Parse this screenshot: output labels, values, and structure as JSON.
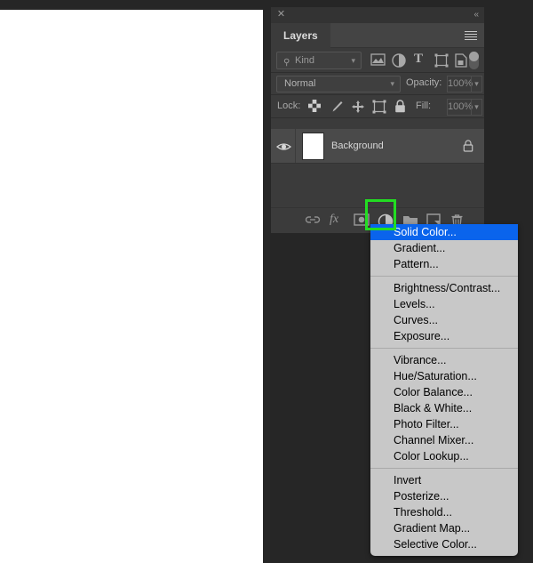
{
  "panel": {
    "close_icon": "close-x-icon",
    "collapse_icon": "double-chevron-left-icon",
    "tab_label": "Layers",
    "menu_icon": "hamburger-menu-icon",
    "filter": {
      "search_icon": "search-icon",
      "kind_label": "Kind",
      "chevron": "⌄",
      "icons": [
        {
          "name": "filter-pixel-icon",
          "glyph": "image"
        },
        {
          "name": "filter-adjustment-icon",
          "glyph": "half-circle"
        },
        {
          "name": "filter-type-icon",
          "glyph": "T"
        },
        {
          "name": "filter-shape-icon",
          "glyph": "shape"
        },
        {
          "name": "filter-smart-object-icon",
          "glyph": "smart"
        }
      ],
      "toggle_name": "filter-enable-toggle"
    },
    "blend": {
      "mode": "Normal",
      "chevron": "⌄",
      "opacity_label": "Opacity:",
      "opacity_value": "100%",
      "opacity_chevron": "⌄"
    },
    "lock": {
      "label": "Lock:",
      "icons": [
        {
          "name": "lock-transparent-pixels-icon"
        },
        {
          "name": "lock-image-pixels-icon"
        },
        {
          "name": "lock-position-icon"
        },
        {
          "name": "lock-artboard-nesting-icon"
        },
        {
          "name": "lock-all-icon"
        }
      ],
      "fill_label": "Fill:",
      "fill_value": "100%",
      "fill_chevron": "⌄"
    },
    "layers": [
      {
        "name": "Background",
        "visible": true,
        "locked": true,
        "thumb_color": "#ffffff"
      }
    ],
    "bottom_buttons": [
      {
        "name": "link-layers-button",
        "label": "link"
      },
      {
        "name": "layer-style-button",
        "label": "fx"
      },
      {
        "name": "layer-mask-button",
        "label": "mask"
      },
      {
        "name": "new-adjustment-layer-button",
        "label": "adjustment"
      },
      {
        "name": "new-group-button",
        "label": "group"
      },
      {
        "name": "new-layer-button",
        "label": "new"
      },
      {
        "name": "delete-layer-button",
        "label": "trash"
      }
    ]
  },
  "highlight": {
    "color": "#22dd22",
    "target": "new-adjustment-layer-button"
  },
  "menu": {
    "selected": "Solid Color...",
    "groups": [
      {
        "items": [
          "Solid Color...",
          "Gradient...",
          "Pattern..."
        ]
      },
      {
        "items": [
          "Brightness/Contrast...",
          "Levels...",
          "Curves...",
          "Exposure..."
        ]
      },
      {
        "items": [
          "Vibrance...",
          "Hue/Saturation...",
          "Color Balance...",
          "Black & White...",
          "Photo Filter...",
          "Channel Mixer...",
          "Color Lookup..."
        ]
      },
      {
        "items": [
          "Invert",
          "Posterize...",
          "Threshold...",
          "Gradient Map...",
          "Selective Color..."
        ]
      }
    ]
  },
  "colors": {
    "panel_bg": "#3b3b3b",
    "desktop_bg": "#262626",
    "menu_bg": "#c8c8c8",
    "menu_highlight": "#0a64ec",
    "document_bg": "#ffffff"
  }
}
